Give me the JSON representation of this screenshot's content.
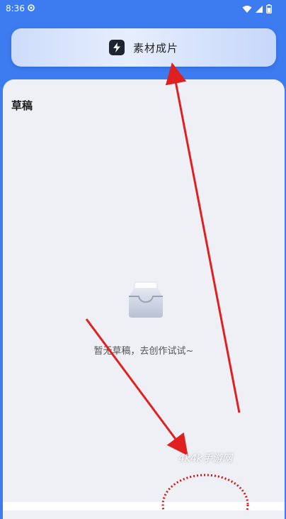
{
  "status_bar": {
    "time": "8:36",
    "icons": [
      "settings-icon",
      "wifi-icon",
      "signal-icon",
      "battery-icon"
    ]
  },
  "top_button": {
    "label": "素材成片",
    "icon": "bolt-icon"
  },
  "drafts": {
    "title": "草稿",
    "empty_message": "暂无草稿，去创作试试~",
    "empty_icon": "empty-inbox-icon"
  },
  "annotation": {
    "watermark": "4k4k手游网",
    "arrow_color": "#e02020"
  },
  "colors": {
    "header_blue": "#3d7bf0",
    "panel_bg": "#eef0f6"
  }
}
